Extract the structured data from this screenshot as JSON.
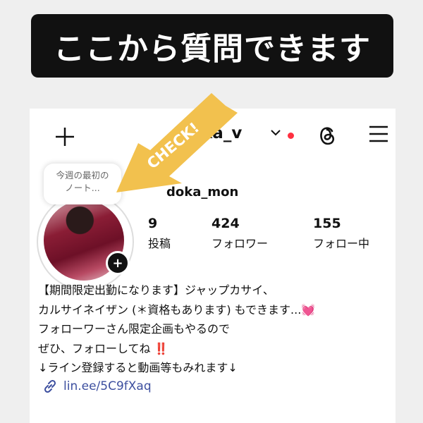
{
  "banner": {
    "text": "ここから質問できます"
  },
  "header": {
    "username_visible": "ka_v",
    "chevron": "chevron-down-icon",
    "notification_dot_color": "#ff3040"
  },
  "note": {
    "line1": "今週の最初の",
    "line2": "ノート..."
  },
  "profile": {
    "handle_visible": "doka_mon",
    "stats": [
      {
        "value": "9",
        "label": "投稿"
      },
      {
        "value": "424",
        "label": "フォロワー"
      },
      {
        "value": "155",
        "label": "フォロー中"
      }
    ]
  },
  "bio": [
    "【期間限定出勤になります】ジャップカサイ、",
    "カルサイネイザン (＊資格もあります) もできます...💓",
    "フォローワーさん限定企画もやるので",
    "ぜひ、フォローしてね ‼️",
    "↓ライン登録すると動画等もみれます↓"
  ],
  "link": {
    "text": "lin.ee/5C9fXaq"
  },
  "overlay": {
    "check_text": "CHECK!",
    "arrow_color": "#f2c14e"
  }
}
